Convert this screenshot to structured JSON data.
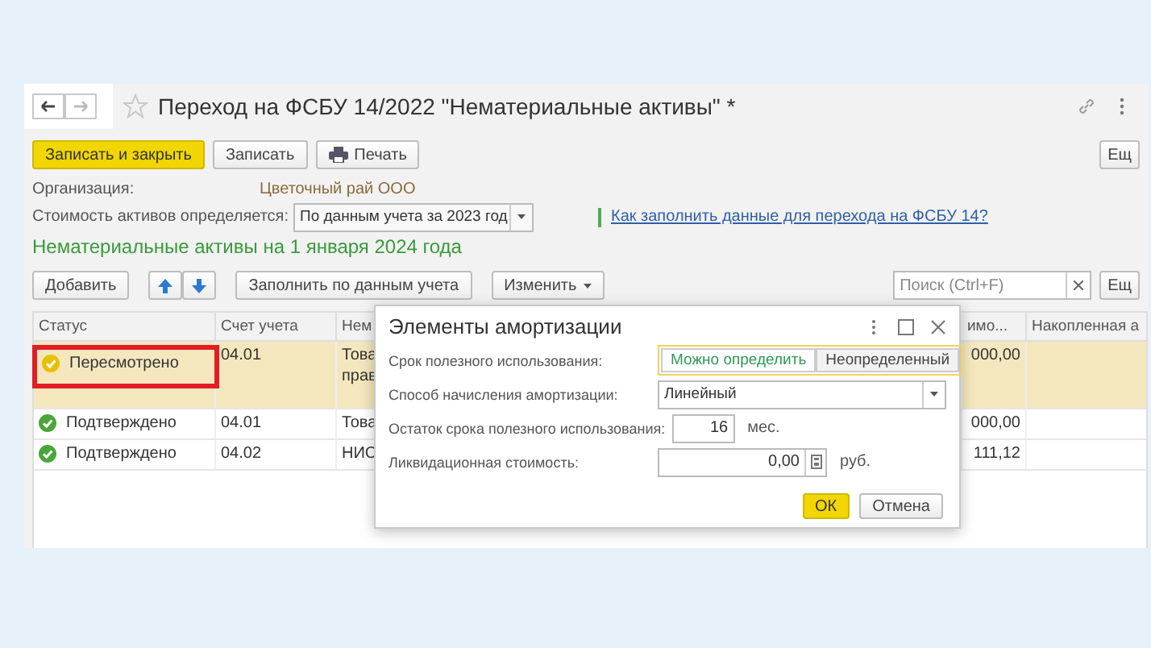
{
  "window": {
    "title": "Переход на ФСБУ 14/2022 \"Нематериальные активы\" *",
    "favorite": false
  },
  "toolbar": {
    "buttons": [
      {
        "label": "Записать и закрыть",
        "kind": "primary"
      },
      {
        "label": "Записать",
        "kind": "plain"
      },
      {
        "label": "Печать",
        "kind": "print"
      }
    ],
    "more": "Ещ"
  },
  "organization": {
    "label": "Организация:",
    "value": "Цветочный рай ООО"
  },
  "cost_basis": {
    "label": "Стоимость активов определяется:",
    "value": "По данным учета за 2023 год"
  },
  "help_link": "Как заполнить данные для перехода на ФСБУ 14?",
  "section_title": "Нематериальные активы на 1 января 2024 года",
  "table_toolbar": {
    "buttons": [
      {
        "label": "Добавить",
        "kind": "plain"
      },
      {
        "kind": "arrows"
      },
      {
        "label": "Заполнить по данным учета",
        "kind": "plain"
      },
      {
        "label": "Изменить",
        "kind": "menu"
      }
    ],
    "search_placeholder": "Поиск (Ctrl+F)",
    "more": "Ещ"
  },
  "table": {
    "columns": [
      "Статус",
      "Счет учета",
      "Нем",
      "имо...",
      "Накопленная а"
    ],
    "rows": [
      {
        "status": "Пересмотрено",
        "kind": "revised",
        "annotated": true,
        "selected": true,
        "account": "04.01",
        "column_3": [
          "Това",
          "прав"
        ],
        "column_4": "000,00"
      },
      {
        "status": "Подтверждено",
        "kind": "confirmed",
        "annotated": false,
        "selected": false,
        "account": "04.01",
        "column_3": [
          "Това"
        ],
        "column_4": "000,00"
      },
      {
        "status": "Подтверждено",
        "kind": "confirmed",
        "annotated": false,
        "selected": false,
        "account": "04.02",
        "column_3": [
          "НИС"
        ],
        "column_4": "111,12"
      }
    ]
  },
  "dialog": {
    "title": "Элементы амортизации",
    "fields": [
      {
        "label": "Срок полезного использования:",
        "kind": "toggle",
        "options": [
          {
            "label": "Можно определить",
            "selected": true
          },
          {
            "label": "Неопределенный",
            "selected": false
          }
        ]
      },
      {
        "label": "Способ начисления амортизации:",
        "kind": "select",
        "value": "Линейный"
      },
      {
        "label": "Остаток срока полезного использования:",
        "kind": "number",
        "value": "16",
        "unit": "мес."
      },
      {
        "label": "Ликвидационная стоимость:",
        "kind": "money",
        "value": "0,00",
        "unit": "руб."
      }
    ],
    "buttons": [
      {
        "label": "ОК",
        "kind": "primary"
      },
      {
        "label": "Отмена",
        "kind": "plain"
      }
    ]
  }
}
